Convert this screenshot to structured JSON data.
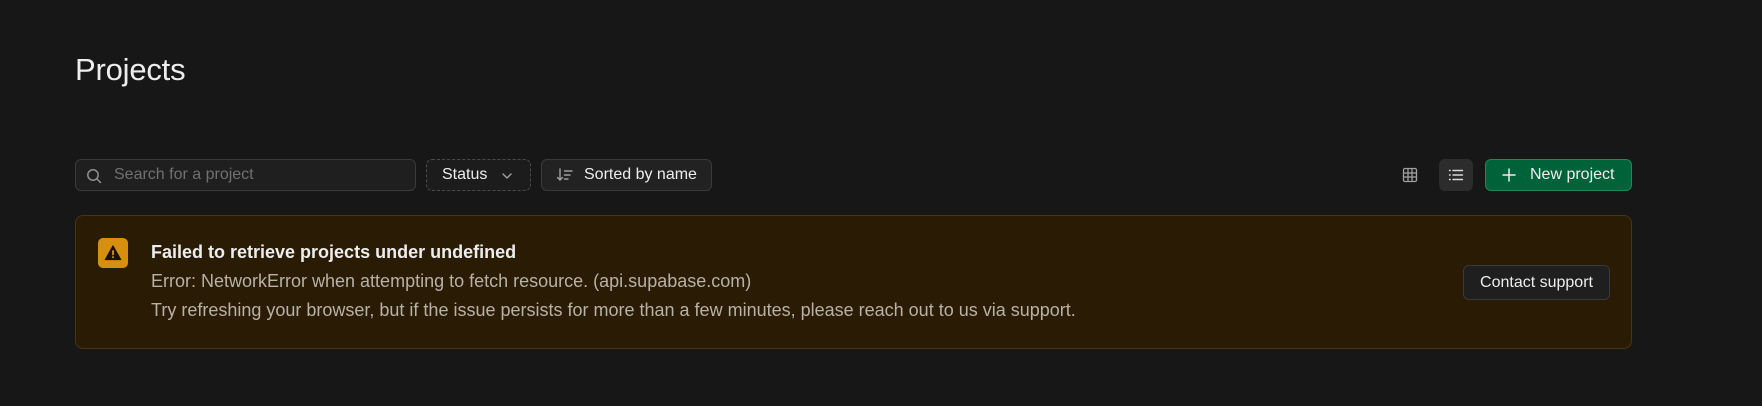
{
  "page": {
    "title": "Projects"
  },
  "toolbar": {
    "search_placeholder": "Search for a project",
    "search_value": "",
    "status_label": "Status",
    "sort_label": "Sorted by name",
    "new_project_label": "New project",
    "active_view": "list"
  },
  "alert": {
    "title": "Failed to retrieve projects under undefined",
    "error_line": "Error: NetworkError when attempting to fetch resource. (api.supabase.com)",
    "help_line": "Try refreshing your browser, but if the issue persists for more than a few minutes, please reach out to us via support.",
    "contact_label": "Contact support"
  },
  "icons": {
    "search": "search-icon",
    "status_chevron": "chevron-down-icon",
    "sort": "sort-icon",
    "grid_view": "grid-icon",
    "list_view": "list-icon",
    "new_project": "plus-icon",
    "warning": "warning-triangle-icon"
  },
  "colors": {
    "background": "#171717",
    "primary_button": "#006239",
    "warning_icon": "#d78f10",
    "alert_background": "#2a1b05",
    "alert_border": "#4a3413"
  }
}
